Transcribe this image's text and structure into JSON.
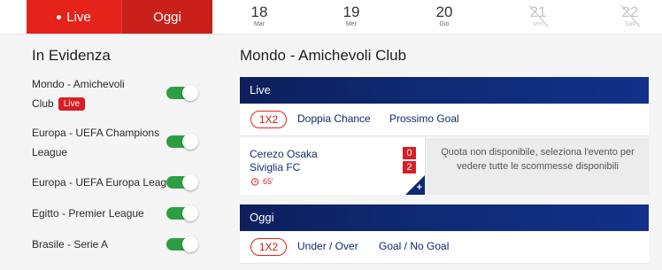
{
  "topbar": {
    "tabs": [
      {
        "label": "Live"
      },
      {
        "label": "Oggi"
      }
    ],
    "days": [
      {
        "num": "18",
        "name": "Mar",
        "disabled": false
      },
      {
        "num": "19",
        "name": "Mer",
        "disabled": false
      },
      {
        "num": "20",
        "name": "Gio",
        "disabled": false
      },
      {
        "num": "21",
        "name": "Ven",
        "disabled": true
      },
      {
        "num": "22",
        "name": "Sab",
        "disabled": true
      }
    ]
  },
  "sidebar": {
    "title": "In Evidenza",
    "items": [
      {
        "line1": "Mondo - Amichevoli",
        "line2": "Club",
        "badge": "Live"
      },
      {
        "line1": "Europa - UEFA Champions",
        "line2": "League"
      },
      {
        "line1": "Europa - UEFA Europa League"
      },
      {
        "line1": "Egitto - Premier League"
      },
      {
        "line1": "Brasile - Serie A"
      }
    ]
  },
  "main": {
    "title": "Mondo - Amichevoli Club",
    "live_section": {
      "heading": "Live",
      "markets": [
        "1X2",
        "Doppia Chance",
        "Prossimo Goal"
      ],
      "event": {
        "home": "Cerezo Osaka",
        "away": "Siviglia FC",
        "home_score": "0",
        "away_score": "2",
        "minute": "65'",
        "plus": "+"
      },
      "unavailable_text": "Quota non disponibile, seleziona l'evento per vedere tutte le scommesse disponibili"
    },
    "today_section": {
      "heading": "Oggi",
      "markets": [
        "1X2",
        "Under / Over",
        "Goal / No Goal"
      ]
    }
  },
  "colors": {
    "brand_red": "#e5231b",
    "navy": "#0e2a73",
    "toggle_green": "#2e9e43"
  }
}
